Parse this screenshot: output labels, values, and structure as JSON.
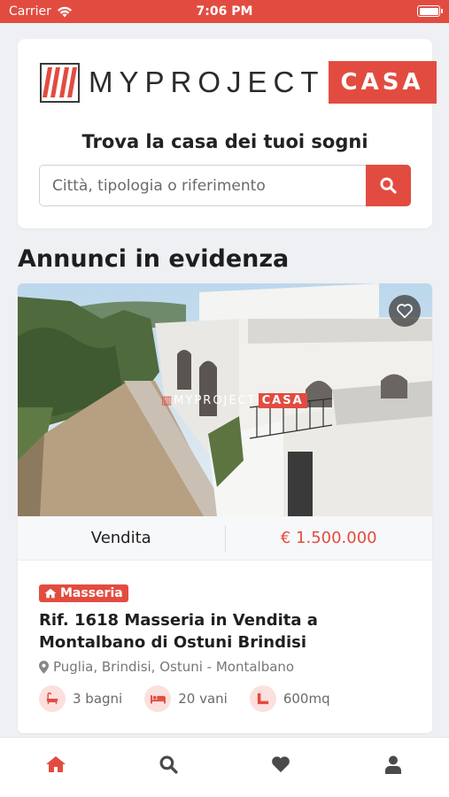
{
  "status_bar": {
    "carrier": "Carrier",
    "time": "7:06 PM"
  },
  "brand": {
    "logo_text": "MYPROJECT",
    "logo_badge": "CASA",
    "accent_color": "#e24c40"
  },
  "hero": {
    "tagline": "Trova la casa dei tuoi sogni",
    "search_placeholder": "Città, tipologia o riferimento"
  },
  "section": {
    "title": "Annunci in evidenza"
  },
  "listing": {
    "photo_watermark": {
      "text": "MYPROJECT",
      "badge": "CASA"
    },
    "contract": "Vendita",
    "price": "€ 1.500.000",
    "type": "Masseria",
    "title": "Rif. 1618 Masseria in Vendita a Montalbano di Ostuni Brindisi",
    "location": "Puglia, Brindisi, Ostuni - Montalbano",
    "features": {
      "baths": "3 bagni",
      "rooms": "20 vani",
      "area": "600mq"
    }
  },
  "tabs": [
    {
      "name": "home",
      "icon": "home-icon",
      "active": true
    },
    {
      "name": "search",
      "icon": "search-icon",
      "active": false
    },
    {
      "name": "favorites",
      "icon": "heart-icon",
      "active": false
    },
    {
      "name": "profile",
      "icon": "user-icon",
      "active": false
    }
  ]
}
